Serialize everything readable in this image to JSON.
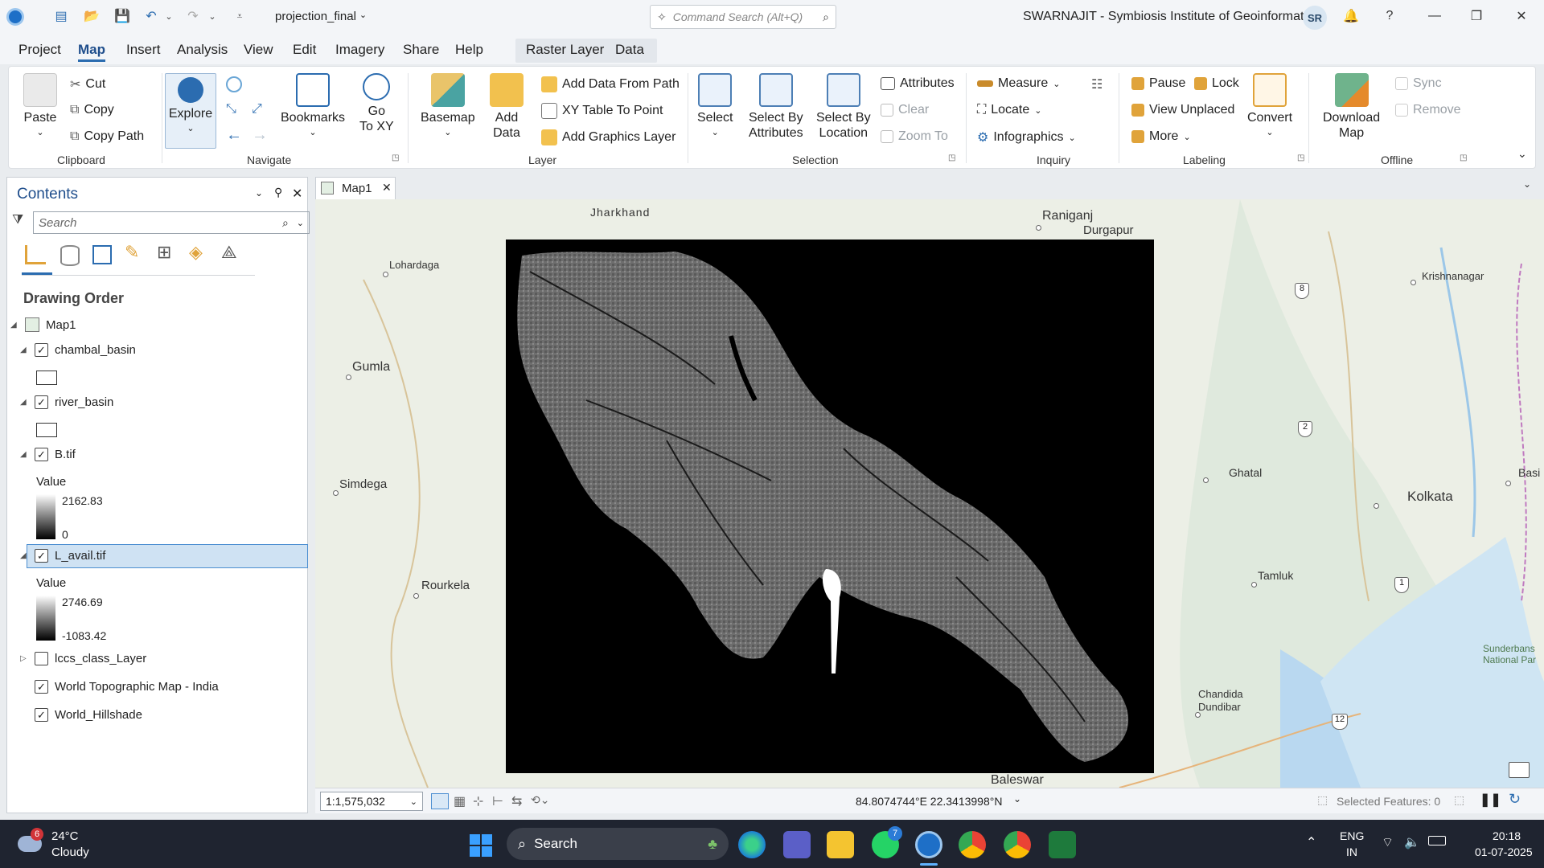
{
  "titlebar": {
    "project_name": "projection_final",
    "search_placeholder": "Command Search (Alt+Q)",
    "user": "SWARNAJIT - Symbiosis Institute of Geoinformatics",
    "avatar": "SR"
  },
  "menu": [
    "Project",
    "Map",
    "Insert",
    "Analysis",
    "View",
    "Edit",
    "Imagery",
    "Share",
    "Help"
  ],
  "context_tabs": [
    "Raster Layer",
    "Data"
  ],
  "ribbon": {
    "clipboard": {
      "group": "Clipboard",
      "paste": "Paste",
      "cut": "Cut",
      "copy": "Copy",
      "copy_path": "Copy Path"
    },
    "navigate": {
      "group": "Navigate",
      "explore": "Explore",
      "bookmarks": "Bookmarks",
      "goto_1": "Go",
      "goto_2": "To XY"
    },
    "layer": {
      "group": "Layer",
      "basemap": "Basemap",
      "add_data_1": "Add",
      "add_data_2": "Data",
      "add_from_path": "Add Data From Path",
      "xy_table": "XY Table To Point",
      "add_graphics": "Add Graphics Layer"
    },
    "selection": {
      "group": "Selection",
      "select": "Select",
      "select_attr_1": "Select By",
      "select_attr_2": "Attributes",
      "select_loc_1": "Select By",
      "select_loc_2": "Location",
      "attributes": "Attributes",
      "clear": "Clear",
      "zoom_to": "Zoom To"
    },
    "inquiry": {
      "group": "Inquiry",
      "measure": "Measure",
      "locate": "Locate",
      "infographics": "Infographics"
    },
    "labeling": {
      "group": "Labeling",
      "pause": "Pause",
      "lock": "Lock",
      "view_unplaced": "View Unplaced",
      "more": "More",
      "convert": "Convert"
    },
    "offline": {
      "group": "Offline",
      "download_1": "Download",
      "download_2": "Map",
      "sync": "Sync",
      "remove": "Remove"
    }
  },
  "contents": {
    "title": "Contents",
    "search_placeholder": "Search",
    "drawing_order": "Drawing Order",
    "map_name": "Map1",
    "layers": [
      {
        "name": "chambal_basin",
        "checked": true
      },
      {
        "name": "river_basin",
        "checked": true
      },
      {
        "name": "B.tif",
        "checked": true,
        "legend_title": "Value",
        "high": "2162.83",
        "low": "0"
      },
      {
        "name": "L_avail.tif",
        "checked": true,
        "legend_title": "Value",
        "high": "2746.69",
        "low": "-1083.42"
      },
      {
        "name": "lccs_class_Layer",
        "checked": false
      },
      {
        "name": "World Topographic Map - India",
        "checked": true
      },
      {
        "name": "World_Hillshade",
        "checked": true
      }
    ]
  },
  "map": {
    "tab": "Map1",
    "places": [
      "Jharkhand",
      "Raniganj",
      "Durgapur",
      "Lohardaga",
      "Krishnanagar",
      "Gumla",
      "Simdega",
      "Ghatal",
      "Kolkata",
      "Basi",
      "Rourkela",
      "Tamluk",
      "Chandida",
      "Dundibar",
      "Sunderbans",
      "National Par",
      "Baleswar"
    ],
    "road_badges": [
      "8",
      "2",
      "1",
      "12"
    ]
  },
  "status": {
    "scale": "1:1,575,032",
    "coords": "84.8074744°E 22.3413998°N",
    "selected": "Selected Features: 0"
  },
  "taskbar": {
    "temp": "24°C",
    "weather": "Cloudy",
    "weather_badge": "6",
    "search": "Search",
    "whatsapp_badge": "7",
    "lang_1": "ENG",
    "lang_2": "IN",
    "time": "20:18",
    "date": "01-07-2025"
  }
}
